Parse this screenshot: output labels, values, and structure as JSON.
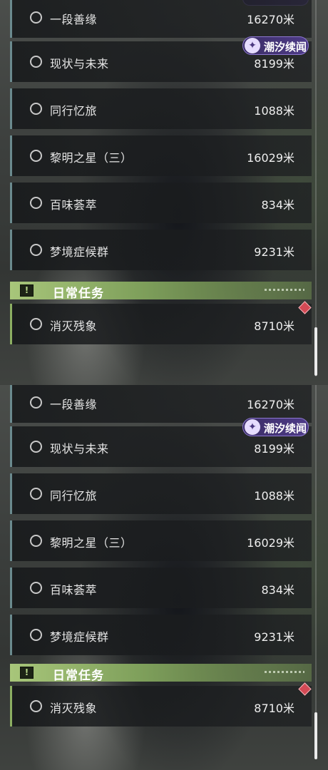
{
  "tag_label": "潮汐续闻",
  "daily_section_title": "日常任务",
  "quests": [
    {
      "name": "一段善缘",
      "distance": "16270米"
    },
    {
      "name": "现状与未来",
      "distance": "8199米"
    },
    {
      "name": "同行忆旅",
      "distance": "1088米"
    },
    {
      "name": "黎明之星（三）",
      "distance": "16029米"
    },
    {
      "name": "百味荟萃",
      "distance": "834米"
    },
    {
      "name": "梦境症候群",
      "distance": "9231米"
    }
  ],
  "daily_quests": [
    {
      "name": "消灭残象",
      "distance": "8710米"
    }
  ],
  "colors": {
    "tag_bg": "#4e3b88",
    "section_green": "#a8c67a",
    "alert_red": "#d44a55"
  },
  "icons": {
    "tag": "tidal-feather-icon",
    "section": "exclamation-icon",
    "alert": "red-diamond-icon"
  }
}
